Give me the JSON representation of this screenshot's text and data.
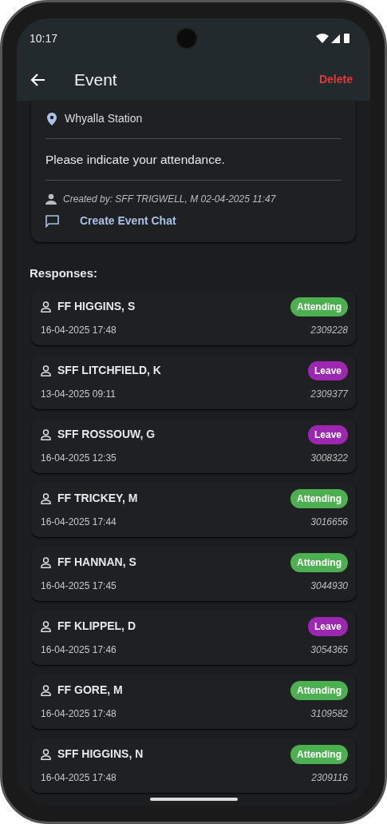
{
  "status_bar": {
    "time": "10:17"
  },
  "app_bar": {
    "title": "Event",
    "action": "Delete"
  },
  "event": {
    "location": "Whyalla Station",
    "description": "Please indicate your attendance.",
    "created_by": "Created by: SFF TRIGWELL, M 02-04-2025 11:47",
    "chat_link": "Create Event Chat"
  },
  "responses_heading": "Responses:",
  "responses": [
    {
      "name": "FF HIGGINS, S",
      "date": "16-04-2025 17:48",
      "number": "2309228",
      "status": "Attending",
      "color": "#4caf50"
    },
    {
      "name": "SFF LITCHFIELD, K",
      "date": "13-04-2025 09:11",
      "number": "2309377",
      "status": "Leave",
      "color": "#9c27b0"
    },
    {
      "name": "SFF ROSSOUW, G",
      "date": "16-04-2025 12:35",
      "number": "3008322",
      "status": "Leave",
      "color": "#9c27b0"
    },
    {
      "name": "FF TRICKEY, M",
      "date": "16-04-2025 17:44",
      "number": "3016656",
      "status": "Attending",
      "color": "#4caf50"
    },
    {
      "name": "FF HANNAN, S",
      "date": "16-04-2025 17:45",
      "number": "3044930",
      "status": "Attending",
      "color": "#4caf50"
    },
    {
      "name": "FF KLIPPEL, D",
      "date": "16-04-2025 17:46",
      "number": "3054365",
      "status": "Leave",
      "color": "#9c27b0"
    },
    {
      "name": "FF GORE, M",
      "date": "16-04-2025 17:48",
      "number": "3109582",
      "status": "Attending",
      "color": "#4caf50"
    },
    {
      "name": "SFF HIGGINS, N",
      "date": "16-04-2025 17:48",
      "number": "2309116",
      "status": "Attending",
      "color": "#4caf50"
    }
  ]
}
